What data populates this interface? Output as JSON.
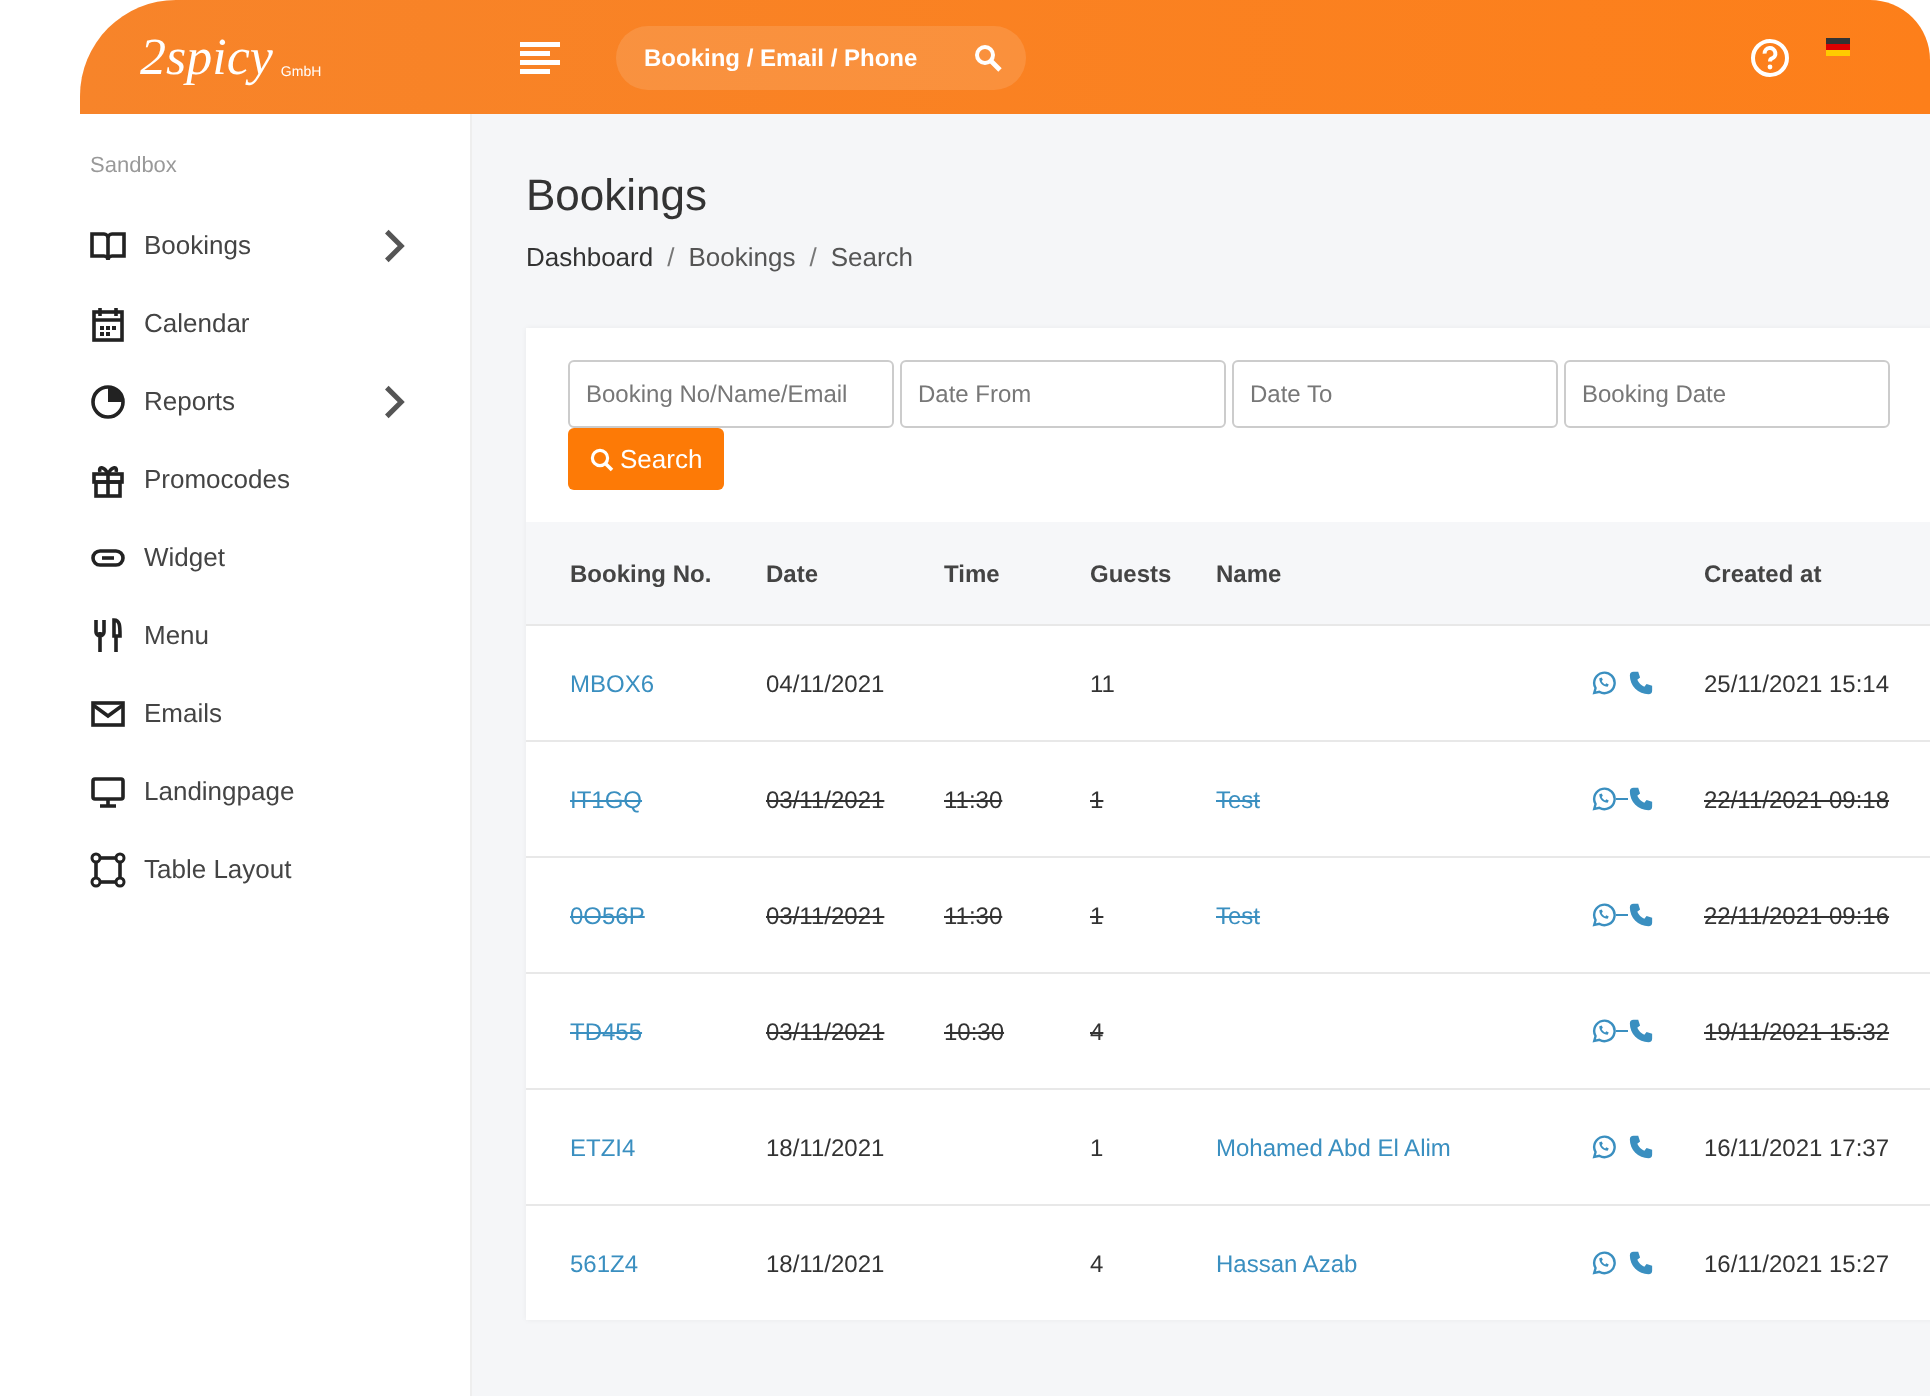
{
  "header": {
    "logo": "2spicy",
    "logo_sub": "GmbH",
    "search": {
      "placeholder": "Booking / Email / Phone"
    }
  },
  "sidebar": {
    "section": "Sandbox",
    "items": [
      {
        "label": "Bookings",
        "expandable": true
      },
      {
        "label": "Calendar",
        "expandable": false
      },
      {
        "label": "Reports",
        "expandable": true
      },
      {
        "label": "Promocodes",
        "expandable": false
      },
      {
        "label": "Widget",
        "expandable": false
      },
      {
        "label": "Menu",
        "expandable": false
      },
      {
        "label": "Emails",
        "expandable": false
      },
      {
        "label": "Landingpage",
        "expandable": false
      },
      {
        "label": "Table Layout",
        "expandable": false
      }
    ]
  },
  "page": {
    "title": "Bookings",
    "breadcrumb": [
      {
        "kind": "link",
        "text": "Dashboard"
      },
      {
        "kind": "separator",
        "text": "/"
      },
      {
        "kind": "link",
        "text": "Bookings"
      },
      {
        "kind": "separator",
        "text": "/"
      },
      {
        "kind": "current",
        "text": "Search"
      }
    ]
  },
  "filters": [
    {
      "placeholder": "Booking No/Name/Email"
    },
    {
      "placeholder": "Date From"
    },
    {
      "placeholder": "Date To"
    },
    {
      "placeholder": "Booking Date"
    }
  ],
  "search_button": "Search",
  "table": {
    "columns": [
      "Booking No.",
      "Date",
      "Time",
      "Guests",
      "Name",
      "Created at"
    ],
    "rows": [
      {
        "booking_no": "MBOX6",
        "date": "04/11/2021",
        "time": "",
        "guests": "11",
        "name": "",
        "created_at": "25/11/2021 15:14",
        "cancelled": false
      },
      {
        "booking_no": "IT1GQ",
        "date": "03/11/2021",
        "time": "11:30",
        "guests": "1",
        "name": "Test",
        "created_at": "22/11/2021 09:18",
        "cancelled": true
      },
      {
        "booking_no": "0O56P",
        "date": "03/11/2021",
        "time": "11:30",
        "guests": "1",
        "name": "Test",
        "created_at": "22/11/2021 09:16",
        "cancelled": true
      },
      {
        "booking_no": "TD455",
        "date": "03/11/2021",
        "time": "10:30",
        "guests": "4",
        "name": "",
        "created_at": "19/11/2021 15:32",
        "cancelled": true
      },
      {
        "booking_no": "ETZI4",
        "date": "18/11/2021",
        "time": "",
        "guests": "1",
        "name": "Mohamed Abd El Alim",
        "created_at": "16/11/2021 17:37",
        "cancelled": false
      },
      {
        "booking_no": "561Z4",
        "date": "18/11/2021",
        "time": "",
        "guests": "4",
        "name": "Hassan Azab",
        "created_at": "16/11/2021 15:27",
        "cancelled": false
      }
    ]
  }
}
